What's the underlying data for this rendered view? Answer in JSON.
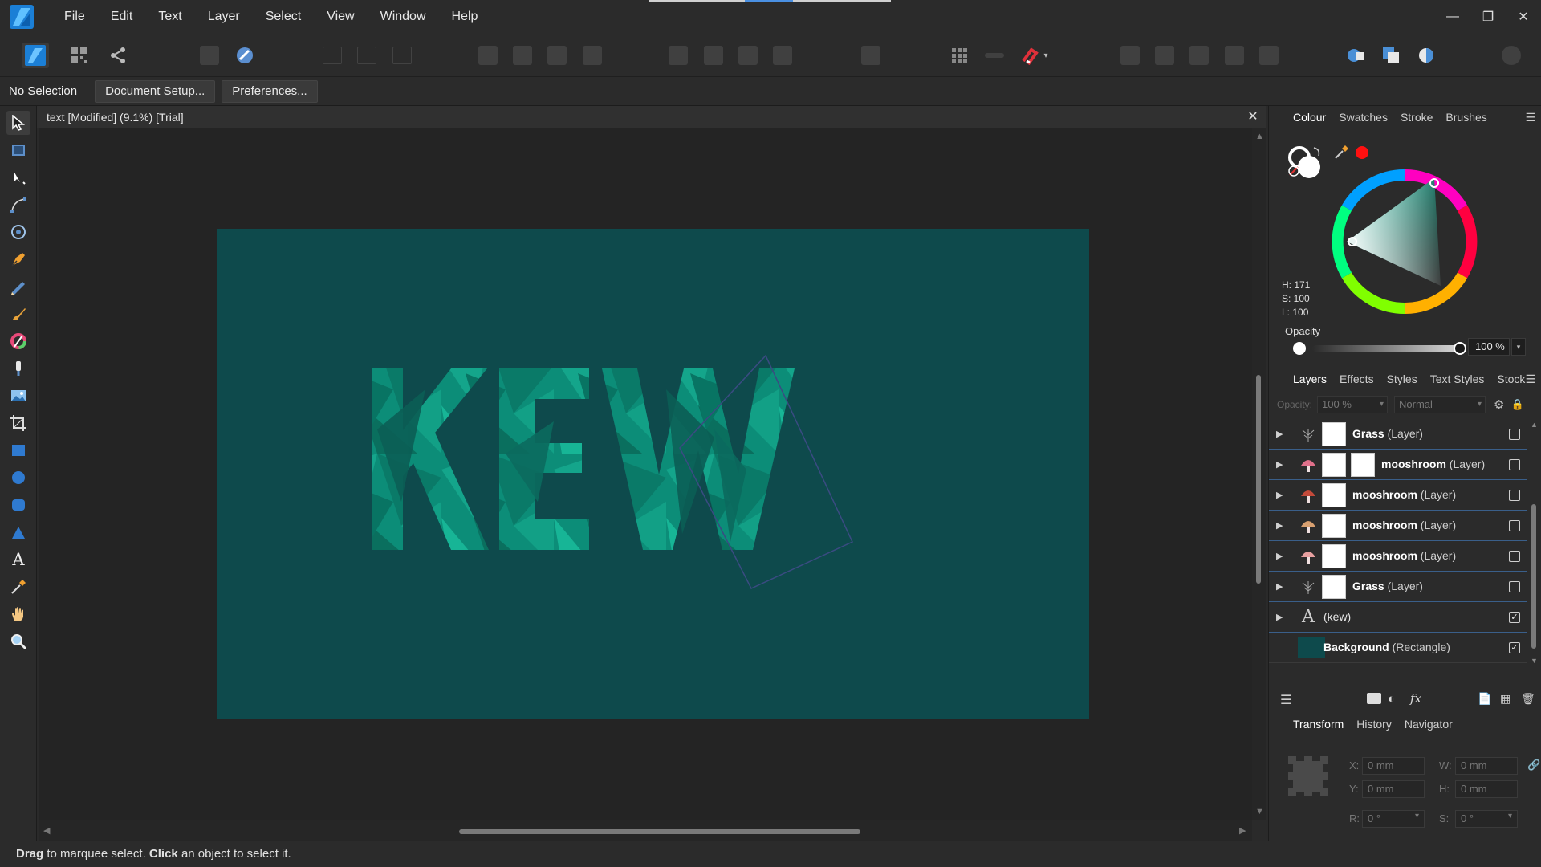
{
  "menu": [
    "File",
    "Edit",
    "Text",
    "Layer",
    "Select",
    "View",
    "Window",
    "Help"
  ],
  "context": {
    "selection": "No Selection",
    "document_setup": "Document Setup...",
    "preferences": "Preferences..."
  },
  "document": {
    "tab_title": "text [Modified] (9.1%) [Trial]",
    "artboard_color": "#0e4a4c",
    "artwork_text": "KEW"
  },
  "colour_panel": {
    "tabs": [
      "Colour",
      "Swatches",
      "Stroke",
      "Brushes"
    ],
    "h": "H: 171",
    "s": "S: 100",
    "l": "L: 100",
    "opacity_label": "Opacity",
    "opacity_value": "100 %",
    "opacity_level": 1.0,
    "current_color": "#2ec4b0"
  },
  "layers_panel": {
    "tabs": [
      "Layers",
      "Effects",
      "Styles",
      "Text Styles",
      "Stock"
    ],
    "opacity_label": "Opacity:",
    "opacity_value": "100 %",
    "blend_mode": "Normal",
    "layers": [
      {
        "name": "Grass",
        "type": "(Layer)",
        "visible": false
      },
      {
        "name": "mooshroom",
        "type": "(Layer)",
        "visible": false
      },
      {
        "name": "mooshroom",
        "type": "(Layer)",
        "visible": false
      },
      {
        "name": "mooshroom",
        "type": "(Layer)",
        "visible": false
      },
      {
        "name": "mooshroom",
        "type": "(Layer)",
        "visible": false
      },
      {
        "name": "Grass",
        "type": "(Layer)",
        "visible": false
      },
      {
        "name": "(kew)",
        "type": "",
        "visible": true
      },
      {
        "name": "Background",
        "type": "(Rectangle)",
        "visible": true
      }
    ]
  },
  "transform_panel": {
    "tabs": [
      "Transform",
      "History",
      "Navigator"
    ],
    "x_label": "X:",
    "x": "0 mm",
    "y_label": "Y:",
    "y": "0 mm",
    "w_label": "W:",
    "w": "0 mm",
    "h_label": "H:",
    "h": "0 mm",
    "r_label": "R:",
    "r": "0 °",
    "s_label": "S:",
    "s": "0 °"
  },
  "status": {
    "drag": "Drag",
    "drag_text": " to marquee select. ",
    "click": "Click",
    "click_text": " an object to select it."
  }
}
